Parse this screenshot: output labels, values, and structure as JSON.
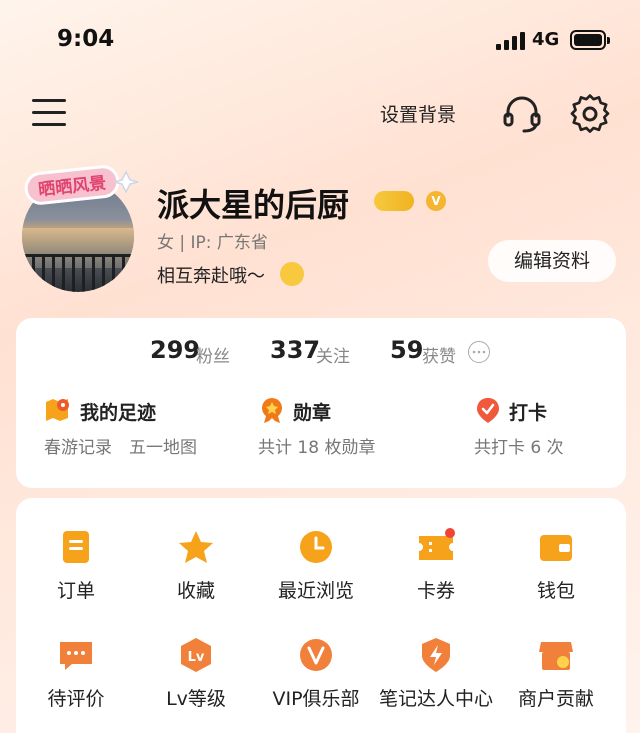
{
  "status_bar": {
    "time": "9:04",
    "network": "4G"
  },
  "header": {
    "set_background": "设置背景"
  },
  "profile": {
    "avatar_sticker_text": "晒晒风景",
    "nickname": "派大星的后厨",
    "gender_ip": "女 | IP: 广东省",
    "bio": "相互奔赴哦～",
    "edit_button": "编辑资料"
  },
  "stats": {
    "fans_count": "299",
    "fans_label": "粉丝",
    "follow_count": "337",
    "follow_label": "关注",
    "likes_count": "59",
    "likes_label": "获赞"
  },
  "features": [
    {
      "title": "我的足迹",
      "sub": "春游记录　五一地图"
    },
    {
      "title": "勋章",
      "sub": "共计 18 枚勋章"
    },
    {
      "title": "打卡",
      "sub": "共打卡 6 次"
    }
  ],
  "grid": [
    {
      "label": "订单",
      "icon": "order-icon"
    },
    {
      "label": "收藏",
      "icon": "star-icon"
    },
    {
      "label": "最近浏览",
      "icon": "clock-icon"
    },
    {
      "label": "卡券",
      "icon": "coupon-icon"
    },
    {
      "label": "钱包",
      "icon": "wallet-icon"
    },
    {
      "label": "待评价",
      "icon": "comment-icon"
    },
    {
      "label": "Lv等级",
      "icon": "lv-icon"
    },
    {
      "label": "VIP俱乐部",
      "icon": "vip-icon"
    },
    {
      "label": "笔记达人中心",
      "icon": "bolt-icon"
    },
    {
      "label": "商户贡献",
      "icon": "shop-icon"
    }
  ],
  "colors": {
    "accent": "#f7a21b",
    "accent_dark": "#f08a1a",
    "badge_red": "#f04438"
  }
}
